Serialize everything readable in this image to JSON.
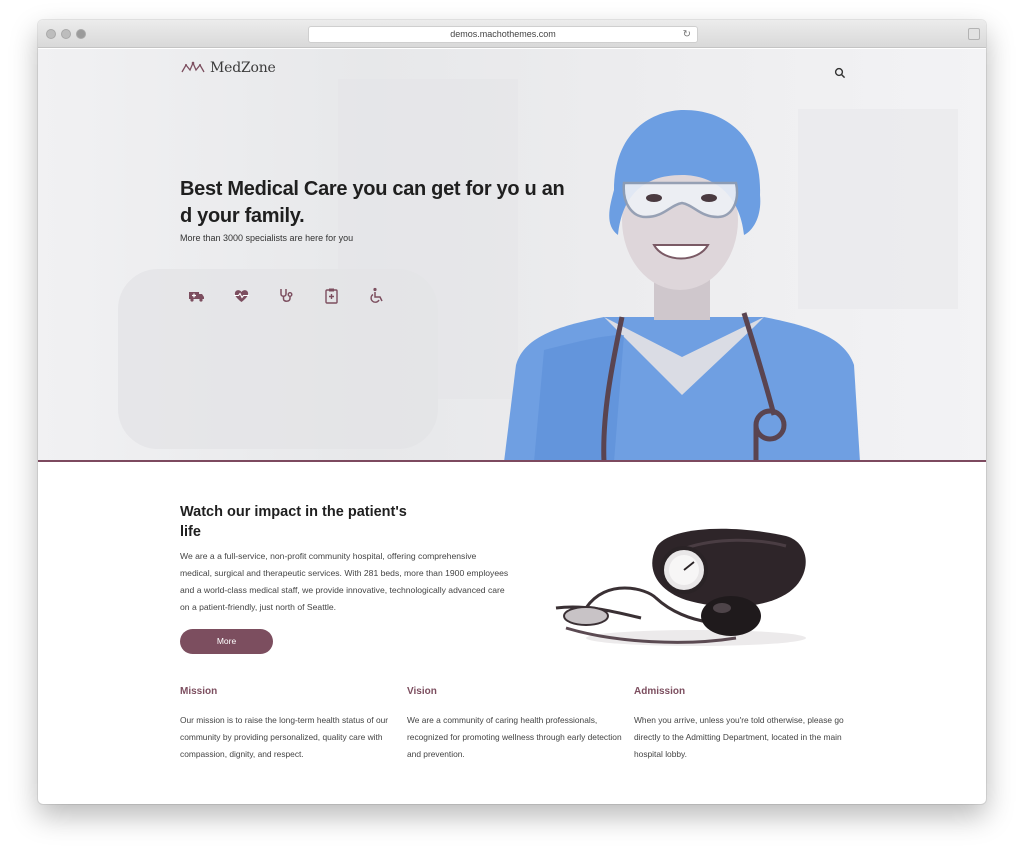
{
  "browser": {
    "url": "demos.machothemes.com"
  },
  "brand": {
    "logo_text": "MedZone"
  },
  "colors": {
    "accent": "#7c4e5f",
    "scrubs": "#6f9fe2"
  },
  "hero": {
    "title": "Best Medical Care you can get for yo u and your family.",
    "subtitle": "More than 3000 specialists are here for you",
    "icons": [
      "ambulance-icon",
      "heartbeat-icon",
      "stethoscope-icon",
      "clipboard-icon",
      "wheelchair-icon"
    ]
  },
  "impact": {
    "title": "Watch our impact in the patient's life",
    "body": "We are a a full-service, non-profit community hospital, offering comprehensive medical, surgical and therapeutic services. With 281 beds, more than 1900 employees and a world-class medical staff, we provide innovative, technologically advanced care on a patient-friendly, just north of Seattle.",
    "button_label": "More"
  },
  "columns": [
    {
      "title": "Mission",
      "body": "Our mission is to raise the long-term health status of our community by providing personalized, quality care with compassion, dignity, and respect."
    },
    {
      "title": "Vision",
      "body": "We are a community of caring health professionals, recognized for promoting wellness through early detection and prevention."
    },
    {
      "title": "Admission",
      "body": "When you arrive, unless you're told otherwise, please go directly to the Admitting Department, located in the main hospital lobby."
    }
  ]
}
